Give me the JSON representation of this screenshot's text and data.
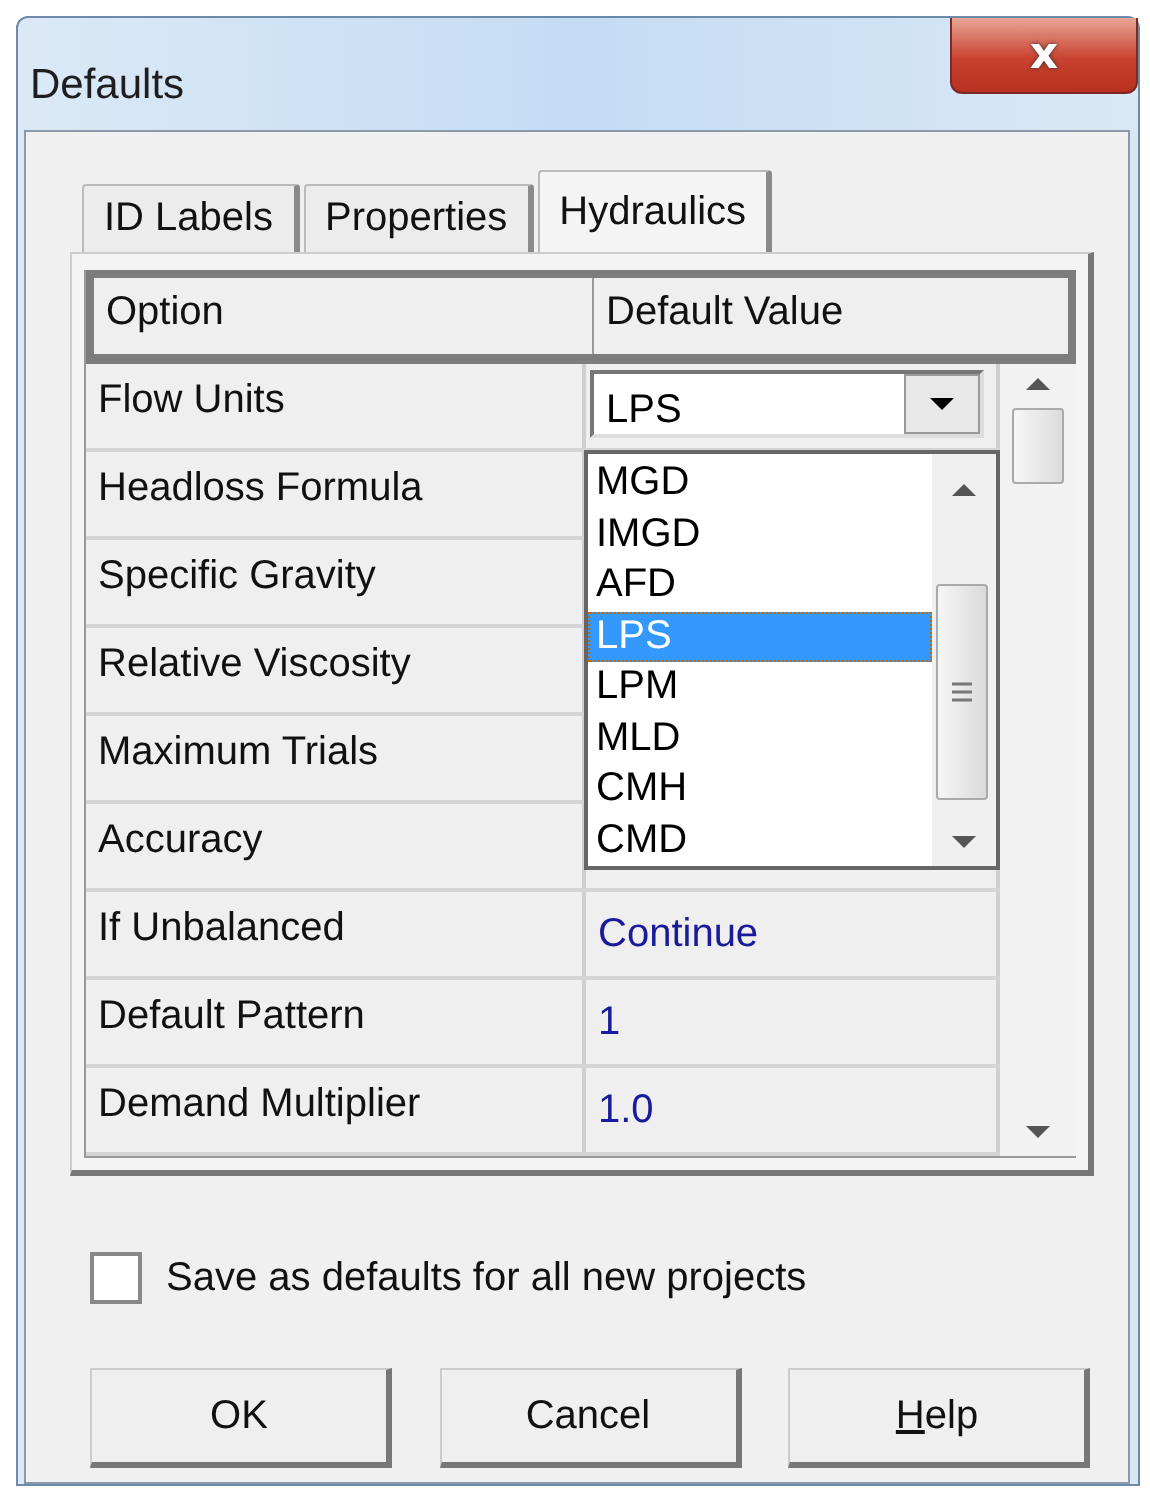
{
  "window": {
    "title": "Defaults",
    "close": "x"
  },
  "tabs": [
    {
      "label": "ID Labels",
      "selected": false
    },
    {
      "label": "Properties",
      "selected": false
    },
    {
      "label": "Hydraulics",
      "selected": true
    }
  ],
  "grid": {
    "columns": [
      "Option",
      "Default Value"
    ],
    "rows": [
      {
        "option": "Flow Units",
        "kind": "combo",
        "value": "LPS"
      },
      {
        "option": "Headloss Formula",
        "kind": "hidden"
      },
      {
        "option": "Specific Gravity",
        "kind": "hidden"
      },
      {
        "option": "Relative Viscosity",
        "kind": "hidden"
      },
      {
        "option": "Maximum Trials",
        "kind": "hidden"
      },
      {
        "option": "Accuracy",
        "kind": "hidden"
      },
      {
        "option": "If Unbalanced",
        "kind": "text",
        "value": "Continue"
      },
      {
        "option": "Default Pattern",
        "kind": "text",
        "value": "1"
      },
      {
        "option": "Demand Multiplier",
        "kind": "text",
        "value": "1.0"
      }
    ]
  },
  "dropdown": {
    "items": [
      {
        "label": "MGD",
        "selected": false
      },
      {
        "label": "IMGD",
        "selected": false
      },
      {
        "label": "AFD",
        "selected": false
      },
      {
        "label": "LPS",
        "selected": true
      },
      {
        "label": "LPM",
        "selected": false
      },
      {
        "label": "MLD",
        "selected": false
      },
      {
        "label": "CMH",
        "selected": false
      },
      {
        "label": "CMD",
        "selected": false
      }
    ]
  },
  "checkbox": {
    "label": "Save as defaults for all new projects",
    "checked": false
  },
  "buttons": [
    {
      "label": "OK",
      "mnemonic": false
    },
    {
      "label": "Cancel",
      "mnemonic": false
    },
    {
      "label": "Help",
      "mnemonic": true
    }
  ]
}
